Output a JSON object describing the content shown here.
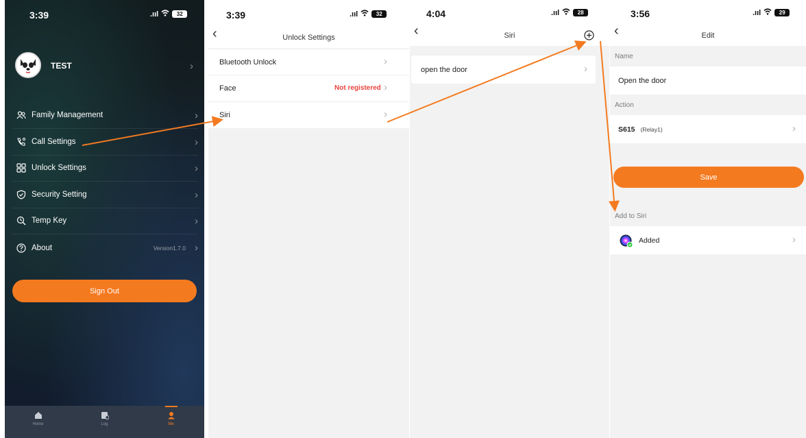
{
  "panel_menu": {
    "time": "3:39",
    "battery": "32",
    "user": "TEST",
    "items": [
      {
        "label": "Family Management",
        "icon": "family-icon"
      },
      {
        "label": "Call Settings",
        "icon": "call-settings-icon"
      },
      {
        "label": "Unlock  Settings",
        "icon": "unlock-grid-icon"
      },
      {
        "label": "Security Setting",
        "icon": "shield-icon"
      },
      {
        "label": "Temp Key",
        "icon": "temp-key-icon"
      },
      {
        "label": "About",
        "icon": "help-icon",
        "version": "Version1.7.0"
      }
    ],
    "sign_out": "Sign Out",
    "tabs": [
      {
        "label": "Home",
        "icon": "home-icon"
      },
      {
        "label": "Log",
        "icon": "log-icon"
      },
      {
        "label": "Me",
        "icon": "me-icon"
      }
    ],
    "accent": "#f47a20"
  },
  "panel_unlock": {
    "time": "3:39",
    "battery": "32",
    "title": "Unlock  Settings",
    "rows": [
      {
        "label": "Bluetooth Unlock",
        "value": ""
      },
      {
        "label": "Face",
        "value": "Not registered"
      },
      {
        "label": "Siri",
        "value": ""
      }
    ],
    "status_color": "#e8433d"
  },
  "panel_siri": {
    "time": "4:04",
    "battery": "28",
    "title": "Siri",
    "rows": [
      {
        "label": "open the door"
      }
    ]
  },
  "panel_edit": {
    "time": "3:56",
    "battery": "29",
    "title": "Edit",
    "name_label": "Name",
    "name_value": "Open the door",
    "action_label": "Action",
    "action_device": "S615",
    "action_relay": "(Relay1)",
    "save": "Save",
    "add_to_siri_label": "Add to Siri",
    "siri_status": "Added"
  }
}
